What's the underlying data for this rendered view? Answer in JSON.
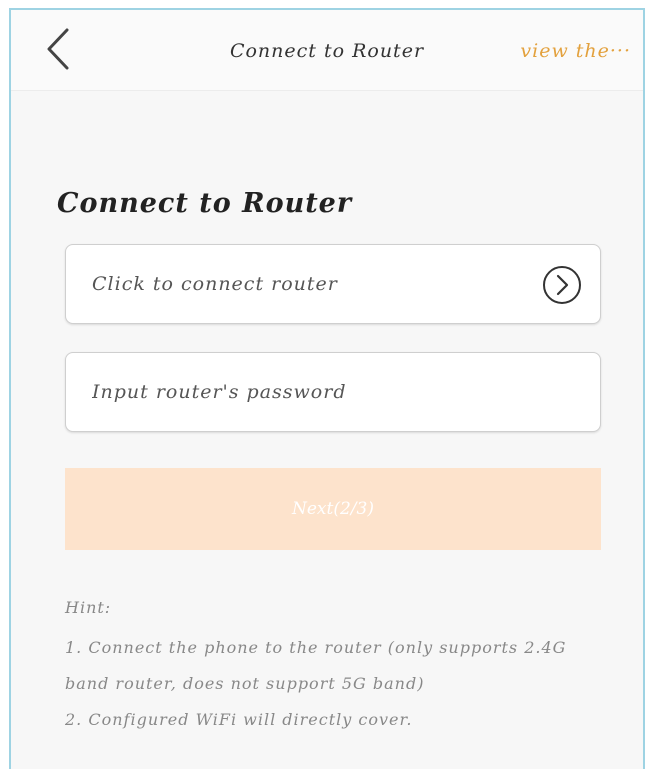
{
  "header": {
    "title": "Connect to Router",
    "action_label": "view the···",
    "back_icon": "chevron-left-icon"
  },
  "main": {
    "section_title": "Connect to Router",
    "connect_field": {
      "label": "Click to connect router",
      "icon": "chevron-right-circle-icon"
    },
    "password_field": {
      "value": "",
      "placeholder": "Input router's password"
    },
    "next_button_label": "Next(2/3)"
  },
  "hint": {
    "title": "Hint:",
    "line1": "1. Connect the phone to the router (only supports 2.4G",
    "line2": "band router, does not support 5G band)",
    "line3": "2. Configured WiFi will directly cover."
  },
  "colors": {
    "accent": "#e3a13d",
    "next_button_bg": "#fde3cc",
    "page_bg": "#f7f7f7"
  }
}
